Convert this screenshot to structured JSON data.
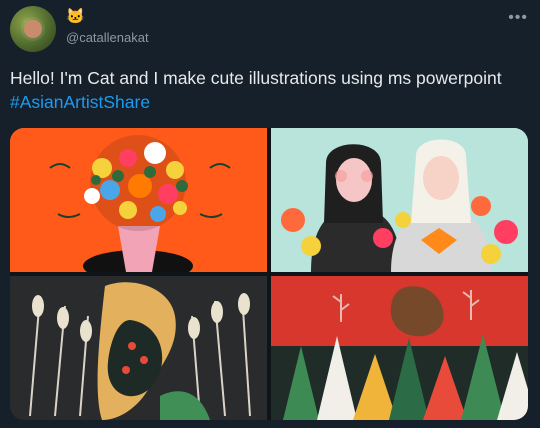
{
  "header": {
    "emoji": "🐱",
    "handle": "@catallenakat",
    "more_label": "•••"
  },
  "tweet": {
    "text": "Hello! I'm Cat and I make cute illustrations using ms powerpoint ",
    "hashtag": "#AsianArtistShare"
  },
  "media": {
    "images": [
      {
        "subject": "flower-bouquet-illustration"
      },
      {
        "subject": "two-women-with-flowers-illustration"
      },
      {
        "subject": "wheat-and-woman-illustration"
      },
      {
        "subject": "forest-trees-illustration"
      }
    ]
  },
  "colors": {
    "background": "#15202b",
    "text": "#e7e9ea",
    "muted": "#8b98a5",
    "accent": "#1d9bf0"
  }
}
